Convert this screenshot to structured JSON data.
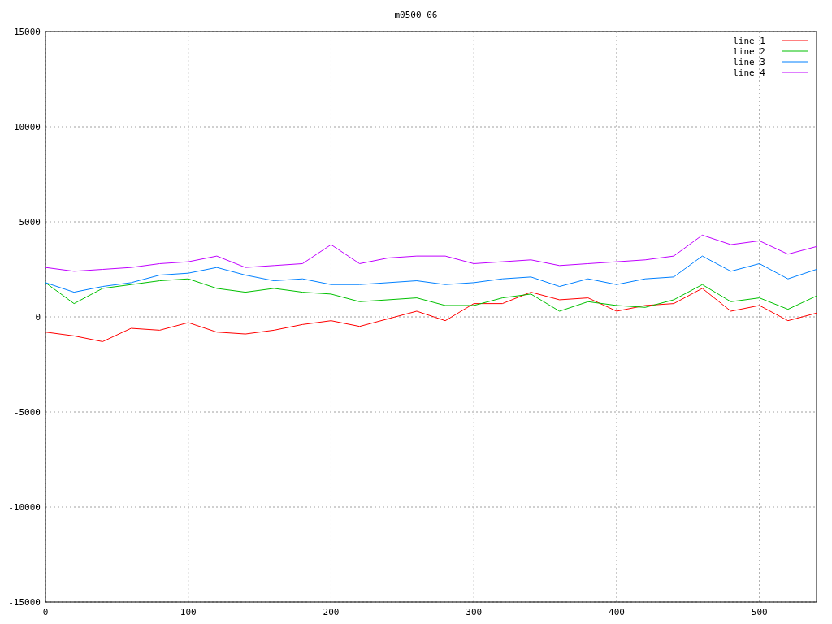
{
  "chart": {
    "chart_data": {
      "type": "line",
      "title": "m0500_06",
      "x": [
        0,
        20,
        40,
        60,
        80,
        100,
        120,
        140,
        160,
        180,
        200,
        220,
        240,
        260,
        280,
        300,
        320,
        340,
        360,
        380,
        400,
        420,
        440,
        460,
        480,
        500,
        520,
        540
      ],
      "series": [
        {
          "name": "line 1",
          "color": "#ff0000",
          "values": [
            -800,
            -1000,
            -1300,
            -600,
            -700,
            -300,
            -800,
            -900,
            -700,
            -400,
            -200,
            -500,
            -100,
            300,
            -200,
            700,
            700,
            1300,
            900,
            1000,
            300,
            600,
            700,
            1500,
            300,
            600,
            -200,
            200
          ]
        },
        {
          "name": "line 2",
          "color": "#00c000",
          "values": [
            1800,
            700,
            1500,
            1700,
            1900,
            2000,
            1500,
            1300,
            1500,
            1300,
            1200,
            800,
            900,
            1000,
            600,
            600,
            1000,
            1200,
            300,
            800,
            600,
            500,
            900,
            1700,
            800,
            1000,
            400,
            1100
          ]
        },
        {
          "name": "line 3",
          "color": "#0080ff",
          "values": [
            1800,
            1300,
            1600,
            1800,
            2200,
            2300,
            2600,
            2200,
            1900,
            2000,
            1700,
            1700,
            1800,
            1900,
            1700,
            1800,
            2000,
            2100,
            1600,
            2000,
            1700,
            2000,
            2100,
            3200,
            2400,
            2800,
            2000,
            2500
          ]
        },
        {
          "name": "line 4",
          "color": "#c000ff",
          "values": [
            2600,
            2400,
            2500,
            2600,
            2800,
            2900,
            3200,
            2600,
            2700,
            2800,
            3800,
            2800,
            3100,
            3200,
            3200,
            2800,
            2900,
            3000,
            2700,
            2800,
            2900,
            3000,
            3200,
            4300,
            3800,
            4000,
            3300,
            3700
          ]
        }
      ],
      "grid": true,
      "legend": true,
      "xlim": [
        0,
        540
      ],
      "ylim": [
        -15000,
        15000
      ],
      "xticks": [
        0,
        100,
        200,
        300,
        400,
        500
      ],
      "yticks": [
        -15000,
        -10000,
        -5000,
        0,
        5000,
        10000,
        15000
      ]
    }
  }
}
